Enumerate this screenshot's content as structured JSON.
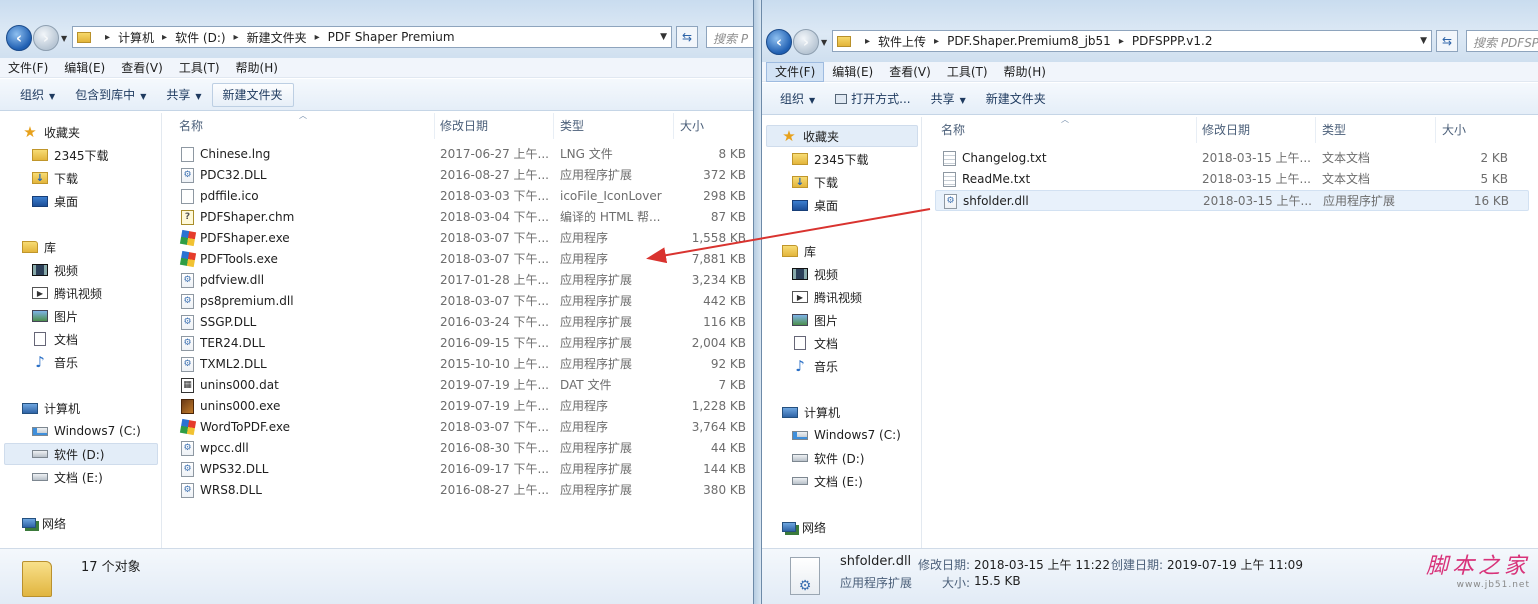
{
  "left_window": {
    "address": [
      "计算机",
      "软件 (D:)",
      "新建文件夹",
      "PDF Shaper Premium"
    ],
    "search_placeholder": "搜索 P",
    "menu": [
      "文件(F)",
      "编辑(E)",
      "查看(V)",
      "工具(T)",
      "帮助(H)"
    ],
    "toolbar": {
      "organize": "组织",
      "include": "包含到库中",
      "share": "共享",
      "new_folder": "新建文件夹"
    },
    "nav": {
      "favorites": "收藏夹",
      "fav_2345": "2345下载",
      "fav_download": "下载",
      "fav_desktop": "桌面",
      "libraries": "库",
      "lib_video": "视频",
      "lib_tencent": "腾讯视频",
      "lib_pictures": "图片",
      "lib_docs": "文档",
      "lib_music": "音乐",
      "computer": "计算机",
      "drive_c": "Windows7 (C:)",
      "drive_d": "软件 (D:)",
      "drive_e": "文档 (E:)",
      "network": "网络"
    },
    "columns": {
      "name": "名称",
      "date": "修改日期",
      "type": "类型",
      "size": "大小"
    },
    "files": [
      {
        "name": "Chinese.lng",
        "date": "2017-06-27 上午...",
        "type": "LNG 文件",
        "size": "8 KB",
        "icon": "blank-file-icon"
      },
      {
        "name": "PDC32.DLL",
        "date": "2016-08-27 上午...",
        "type": "应用程序扩展",
        "size": "372 KB",
        "icon": "dll-file-icon"
      },
      {
        "name": "pdffile.ico",
        "date": "2018-03-03 下午...",
        "type": "icoFile_IconLover",
        "size": "298 KB",
        "icon": "blank-file-icon"
      },
      {
        "name": "PDFShaper.chm",
        "date": "2018-03-04 下午...",
        "type": "编译的 HTML 帮...",
        "size": "87 KB",
        "icon": "chm-file-icon"
      },
      {
        "name": "PDFShaper.exe",
        "date": "2018-03-07 下午...",
        "type": "应用程序",
        "size": "1,558 KB",
        "icon": "exe-file-icon"
      },
      {
        "name": "PDFTools.exe",
        "date": "2018-03-07 下午...",
        "type": "应用程序",
        "size": "7,881 KB",
        "icon": "exe-file-icon"
      },
      {
        "name": "pdfview.dll",
        "date": "2017-01-28 上午...",
        "type": "应用程序扩展",
        "size": "3,234 KB",
        "icon": "dll-file-icon"
      },
      {
        "name": "ps8premium.dll",
        "date": "2018-03-07 下午...",
        "type": "应用程序扩展",
        "size": "442 KB",
        "icon": "dll-file-icon"
      },
      {
        "name": "SSGP.DLL",
        "date": "2016-03-24 下午...",
        "type": "应用程序扩展",
        "size": "116 KB",
        "icon": "dll-file-icon"
      },
      {
        "name": "TER24.DLL",
        "date": "2016-09-15 下午...",
        "type": "应用程序扩展",
        "size": "2,004 KB",
        "icon": "dll-file-icon"
      },
      {
        "name": "TXML2.DLL",
        "date": "2015-10-10 上午...",
        "type": "应用程序扩展",
        "size": "92 KB",
        "icon": "dll-file-icon"
      },
      {
        "name": "unins000.dat",
        "date": "2019-07-19 上午...",
        "type": "DAT 文件",
        "size": "7 KB",
        "icon": "dat-file-icon"
      },
      {
        "name": "unins000.exe",
        "date": "2019-07-19 上午...",
        "type": "应用程序",
        "size": "1,228 KB",
        "icon": "installer-icon"
      },
      {
        "name": "WordToPDF.exe",
        "date": "2018-03-07 下午...",
        "type": "应用程序",
        "size": "3,764 KB",
        "icon": "exe-file-icon"
      },
      {
        "name": "wpcc.dll",
        "date": "2016-08-30 下午...",
        "type": "应用程序扩展",
        "size": "44 KB",
        "icon": "dll-file-icon"
      },
      {
        "name": "WPS32.DLL",
        "date": "2016-09-17 下午...",
        "type": "应用程序扩展",
        "size": "144 KB",
        "icon": "dll-file-icon"
      },
      {
        "name": "WRS8.DLL",
        "date": "2016-08-27 上午...",
        "type": "应用程序扩展",
        "size": "380 KB",
        "icon": "dll-file-icon"
      }
    ],
    "status": "17 个对象"
  },
  "right_window": {
    "address": [
      "软件上传",
      "PDF.Shaper.Premium8_jb51",
      "PDFSPPP.v1.2"
    ],
    "search_placeholder": "搜索 PDFSPPP",
    "menu": [
      "文件(F)",
      "编辑(E)",
      "查看(V)",
      "工具(T)",
      "帮助(H)"
    ],
    "toolbar": {
      "organize": "组织",
      "open_with": "打开方式...",
      "share": "共享",
      "new_folder": "新建文件夹"
    },
    "columns": {
      "name": "名称",
      "date": "修改日期",
      "type": "类型",
      "size": "大小"
    },
    "files": [
      {
        "name": "Changelog.txt",
        "date": "2018-03-15 上午...",
        "type": "文本文档",
        "size": "2 KB",
        "icon": "text-file-icon"
      },
      {
        "name": "ReadMe.txt",
        "date": "2018-03-15 上午...",
        "type": "文本文档",
        "size": "5 KB",
        "icon": "text-file-icon"
      },
      {
        "name": "shfolder.dll",
        "date": "2018-03-15 上午...",
        "type": "应用程序扩展",
        "size": "16 KB",
        "icon": "dll-file-icon"
      }
    ],
    "details": {
      "filename": "shfolder.dll",
      "modified_label": "修改日期:",
      "modified_value": "2018-03-15 上午 11:22",
      "created_label": "创建日期:",
      "created_value": "2019-07-19 上午 11:09",
      "type": "应用程序扩展",
      "size_label": "大小:",
      "size_value": "15.5 KB"
    }
  },
  "watermark": {
    "text": "脚本之家",
    "url": "www.jb51.net"
  },
  "colors": {
    "arrow": "#d9332f",
    "selection": "#e3edf8",
    "toolbar": "#e5eef8"
  }
}
